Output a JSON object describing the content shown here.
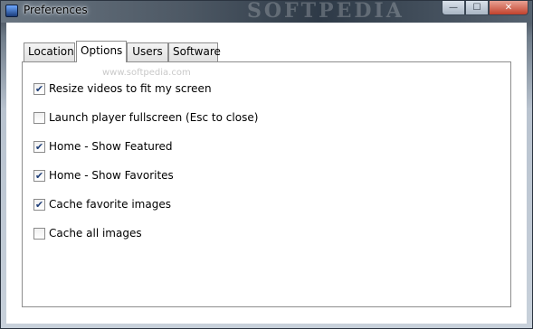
{
  "window": {
    "title": "Preferences",
    "watermark": "SOFTPEDIA",
    "controls": {
      "minimize": "—",
      "maximize": "☐",
      "close": "✕"
    }
  },
  "tabs": [
    {
      "label": "Location",
      "active": false
    },
    {
      "label": "Options",
      "active": true
    },
    {
      "label": "Users",
      "active": false
    },
    {
      "label": "Software",
      "active": false
    }
  ],
  "overlay_watermark": "www.softpedia.com",
  "options": [
    {
      "label": "Resize videos to fit my screen",
      "checked": true
    },
    {
      "label": "Launch player fullscreen (Esc to close)",
      "checked": false
    },
    {
      "label": "Home - Show Featured",
      "checked": true
    },
    {
      "label": "Home - Show Favorites",
      "checked": true
    },
    {
      "label": "Cache favorite images",
      "checked": true
    },
    {
      "label": "Cache all images",
      "checked": false
    }
  ],
  "icons": {
    "app": "app-icon",
    "check": "checkmark-icon"
  }
}
